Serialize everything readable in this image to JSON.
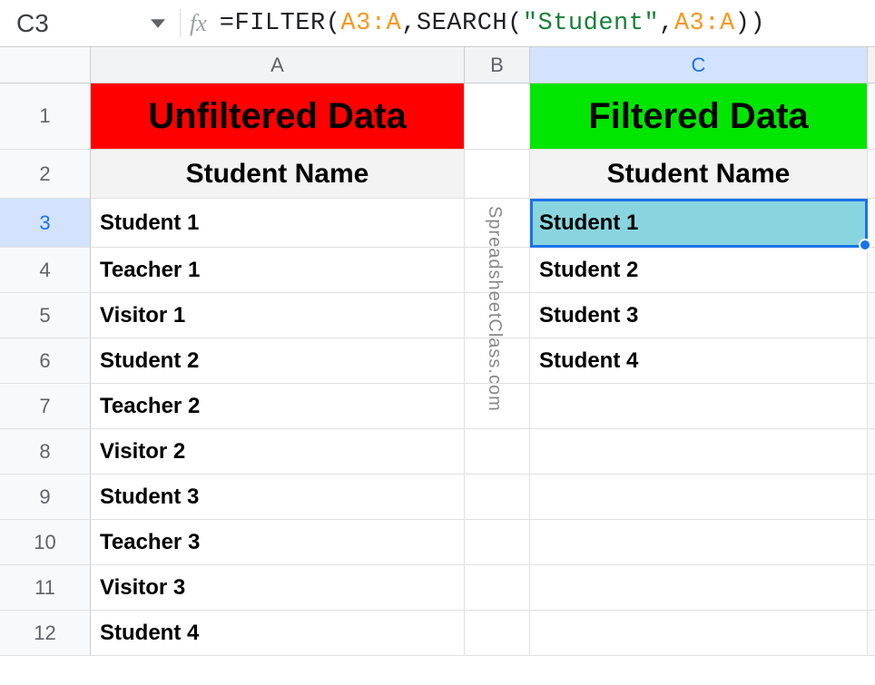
{
  "nameBox": "C3",
  "formula": {
    "prefix": "=",
    "fn1": "FILTER",
    "open1": "(",
    "range1": "A3:A",
    "comma1": ",",
    "fn2": "SEARCH",
    "open2": "(",
    "str": "\"Student\"",
    "comma2": ",",
    "range2": "A3:A",
    "close2": ")",
    "close1": ")"
  },
  "columns": {
    "A": "A",
    "B": "B",
    "C": "C"
  },
  "rows": [
    "1",
    "2",
    "3",
    "4",
    "5",
    "6",
    "7",
    "8",
    "9",
    "10",
    "11",
    "12"
  ],
  "headers": {
    "unfiltered": "Unfiltered Data",
    "filtered": "Filtered Data",
    "subA": "Student Name",
    "subC": "Student Name"
  },
  "colA": [
    "Student 1",
    "Teacher 1",
    "Visitor 1",
    "Student 2",
    "Teacher 2",
    "Visitor 2",
    "Student 3",
    "Teacher 3",
    "Visitor 3",
    "Student 4"
  ],
  "colC": [
    "Student 1",
    "Student 2",
    "Student 3",
    "Student 4",
    "",
    "",
    "",
    "",
    "",
    ""
  ],
  "selectedCell": "C3",
  "watermark": "SpreadsheetClass.com"
}
